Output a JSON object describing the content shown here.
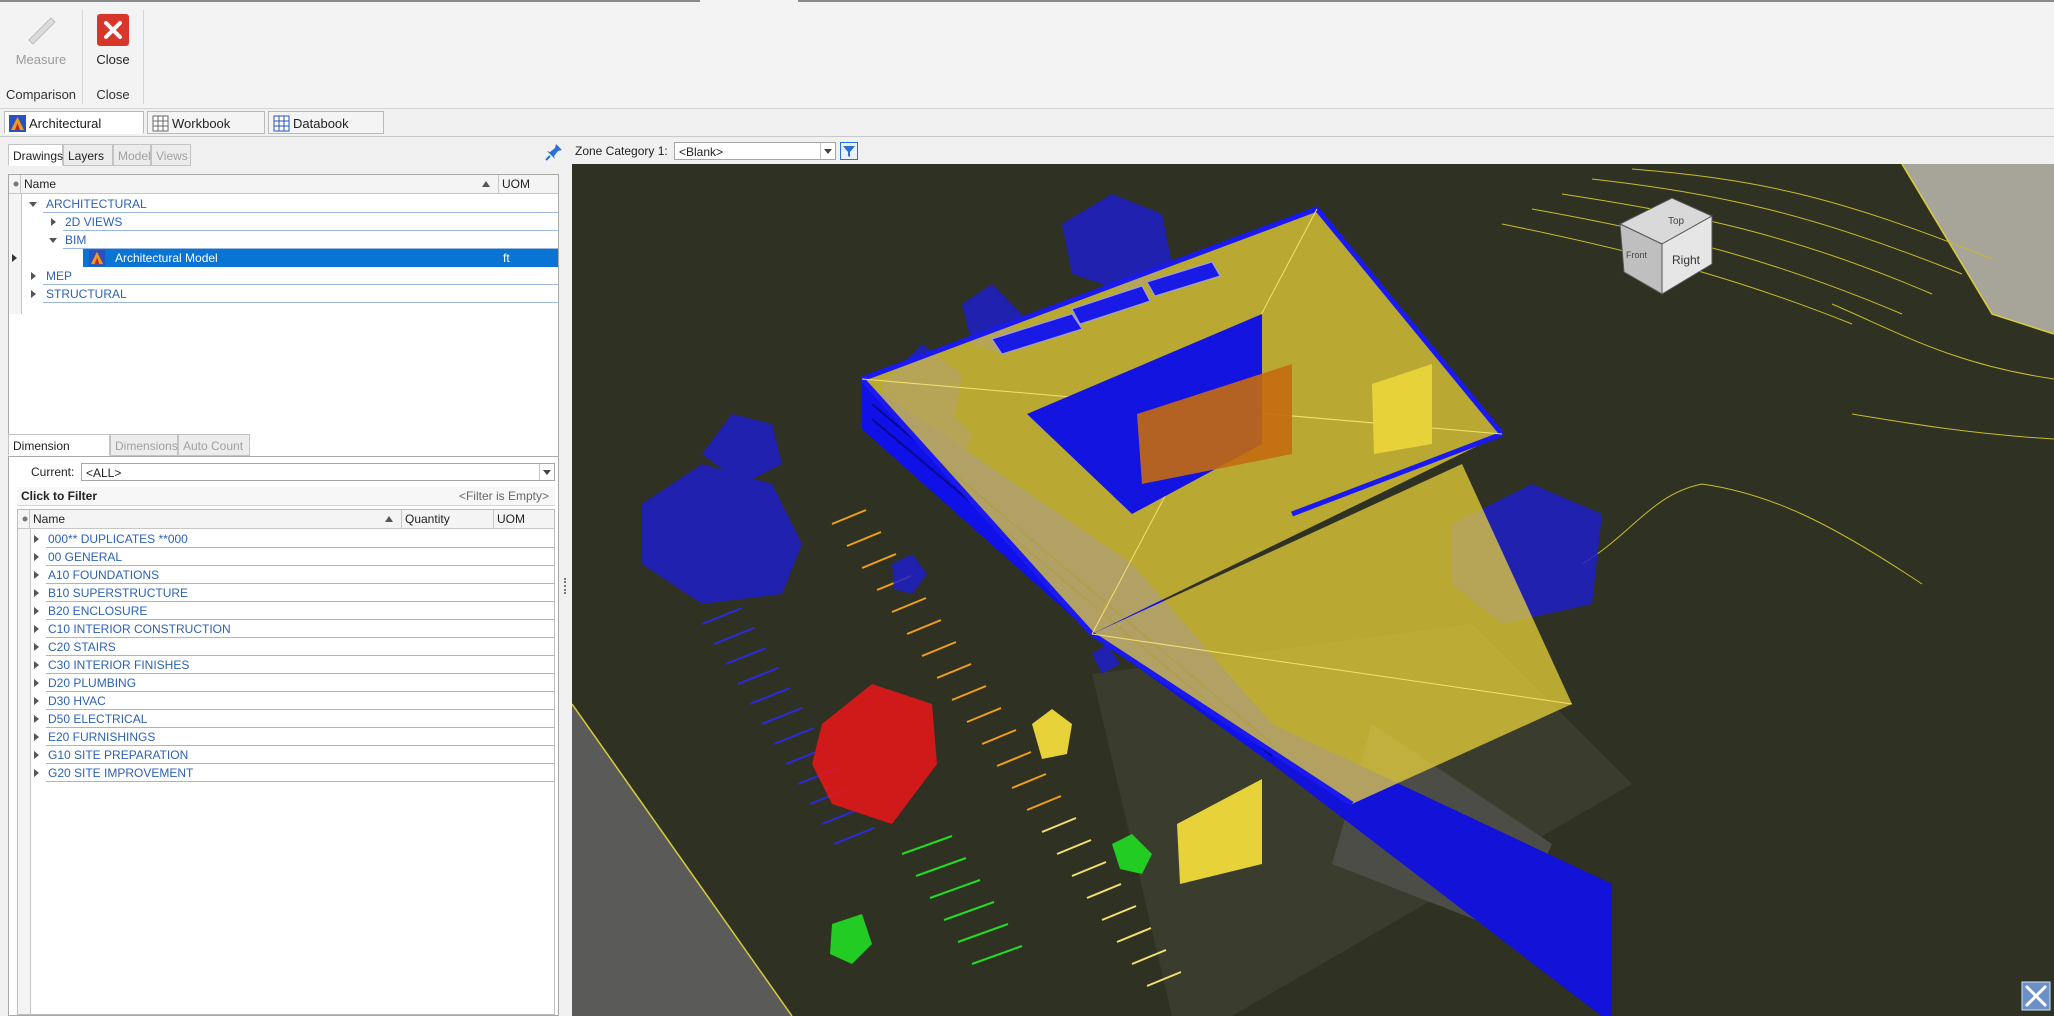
{
  "ribbon": {
    "measure_label": "Measure",
    "close_label": "Close",
    "group_comparison": "Comparison",
    "group_close": "Close"
  },
  "doc_tabs": [
    {
      "label": "Architectural Model",
      "active": true
    },
    {
      "label": "Workbook View",
      "active": false
    },
    {
      "label": "Databook View",
      "active": false
    }
  ],
  "drawings_panel": {
    "tabs": [
      "Drawings",
      "Layers",
      "Model",
      "Views"
    ],
    "col_name": "Name",
    "col_uom": "UOM",
    "rows": [
      {
        "label": "ARCHITECTURAL",
        "level": 0,
        "state": "open"
      },
      {
        "label": "2D VIEWS",
        "level": 1,
        "state": "closed"
      },
      {
        "label": "BIM",
        "level": 1,
        "state": "open"
      },
      {
        "label": "Architectural Model",
        "level": 2,
        "state": "leaf",
        "uom": "ft",
        "selected": true
      },
      {
        "label": "MEP",
        "level": 0,
        "state": "closed"
      },
      {
        "label": "STRUCTURAL",
        "level": 0,
        "state": "closed"
      }
    ]
  },
  "dimension_panel": {
    "tabs": [
      "Dimension Groups",
      "Dimensions",
      "Auto Count"
    ],
    "current_label": "Current:",
    "current_value": "<ALL>",
    "filter_title": "Click to Filter",
    "filter_state": "<Filter is Empty>",
    "col_name": "Name",
    "col_qty": "Quantity",
    "col_uom": "UOM",
    "groups": [
      "000** DUPLICATES **000",
      "00 GENERAL",
      "A10 FOUNDATIONS",
      "B10 SUPERSTRUCTURE",
      "B20 ENCLOSURE",
      "C10 INTERIOR CONSTRUCTION",
      "C20 STAIRS",
      "C30 INTERIOR FINISHES",
      "D20 PLUMBING",
      "D30 HVAC",
      "D50 ELECTRICAL",
      "E20 FURNISHINGS",
      "G10 SITE PREPARATION",
      "G20 SITE IMPROVEMENT"
    ]
  },
  "viewport": {
    "zone_label": "Zone Category 1:",
    "zone_value": "<Blank>",
    "viewcube_top": "Top",
    "viewcube_front": "Front",
    "viewcube_right": "Right"
  },
  "colors": {
    "selection": "#0a74d4",
    "tree_text": "#2d62b6",
    "model_blue": "#1a1ae6",
    "model_yellow": "#e8d23a",
    "ground": "#2f3122",
    "close_red": "#d9362b"
  }
}
